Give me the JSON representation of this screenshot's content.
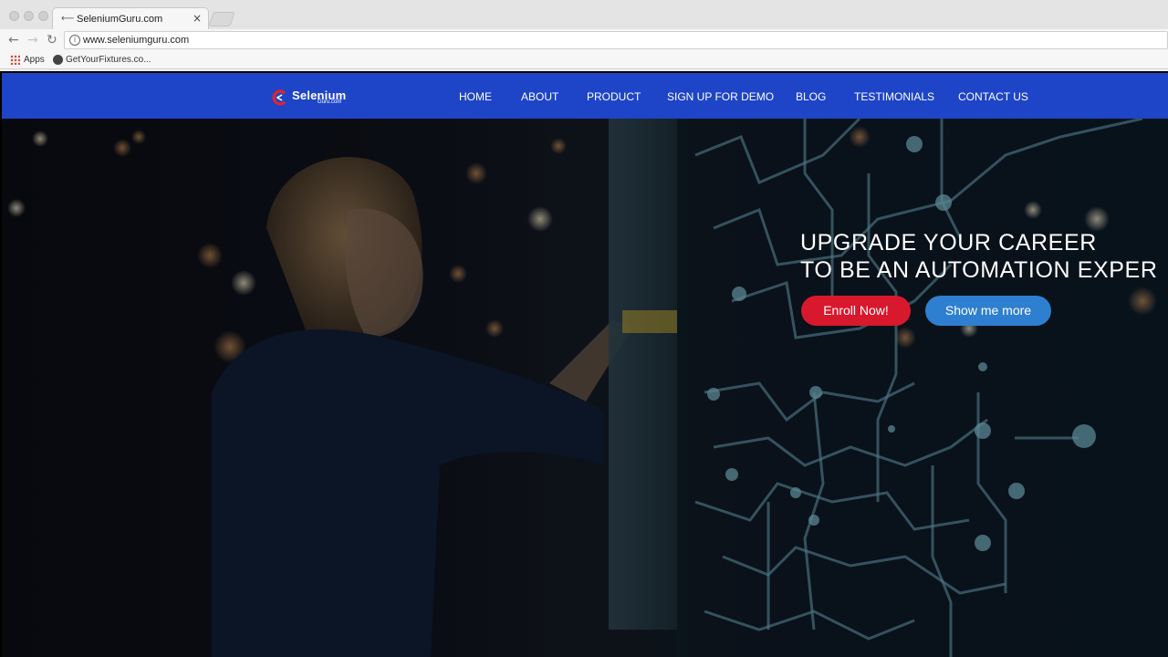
{
  "browser": {
    "tab_title": "SeleniumGuru.com",
    "tab_favicon_icon": "loading-icon",
    "tab_close_glyph": "×",
    "url": "www.seleniumguru.com",
    "bookmarks": [
      {
        "label": "Apps",
        "icon": "apps-grid-icon"
      },
      {
        "label": "GetYourFixtures.co...",
        "icon": "globe-icon"
      }
    ]
  },
  "site": {
    "logo": {
      "name": "Selenium",
      "sub": "Guru.com"
    },
    "menu": [
      "HOME",
      "ABOUT",
      "PRODUCT",
      "SIGN UP FOR DEMO",
      "BLOG",
      "TESTIMONIALS",
      "CONTACT US"
    ],
    "header_color": "#1e44c8"
  },
  "hero": {
    "headline_line1": "UPGRADE YOUR CAREER",
    "headline_line2": "TO BE AN AUTOMATION EXPER",
    "enroll_label": "Enroll Now!",
    "more_label": "Show me more",
    "enroll_color": "#d8182c",
    "more_color": "#2f7fd0"
  }
}
